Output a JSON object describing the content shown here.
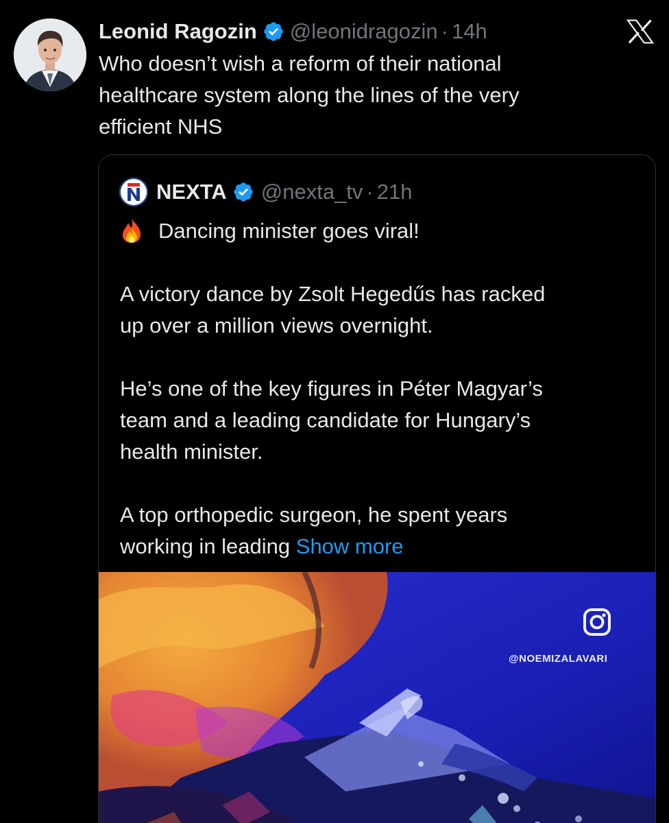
{
  "tweet": {
    "author_name": "Leonid Ragozin",
    "handle": "@leonidragozin",
    "separator": "·",
    "time": "14h",
    "text_lines": [
      "Who doesn’t wish a reform of their national",
      "healthcare system along the lines of the very",
      "efficient NHS"
    ]
  },
  "quote": {
    "author_name": "NEXTA",
    "handle": "@nexta_tv",
    "separator": "·",
    "time": "21h",
    "headline": "Dancing minister goes viral!",
    "para1": [
      "A victory dance by Zsolt Hegedűs has racked",
      "up over a million views overnight."
    ],
    "para2": [
      "He’s one of the key figures in Péter Magyar’s",
      "team and a leading candidate for Hungary’s",
      "health minister."
    ],
    "para3_line1": "A top orthopedic surgeon, he spent years",
    "para3_line2": "working in leading ",
    "show_more": "Show more",
    "media": {
      "watermark": "@NOEMIZALAVARI"
    }
  },
  "icons": {
    "verified": "verified-badge-icon",
    "x_logo": "x-logo-icon",
    "fire": "fire-emoji-icon",
    "instagram": "instagram-icon"
  },
  "colors": {
    "background": "#000000",
    "text": "#e7e9ea",
    "secondary": "#71767b",
    "link": "#1d9bf0",
    "border": "#2f3336"
  }
}
